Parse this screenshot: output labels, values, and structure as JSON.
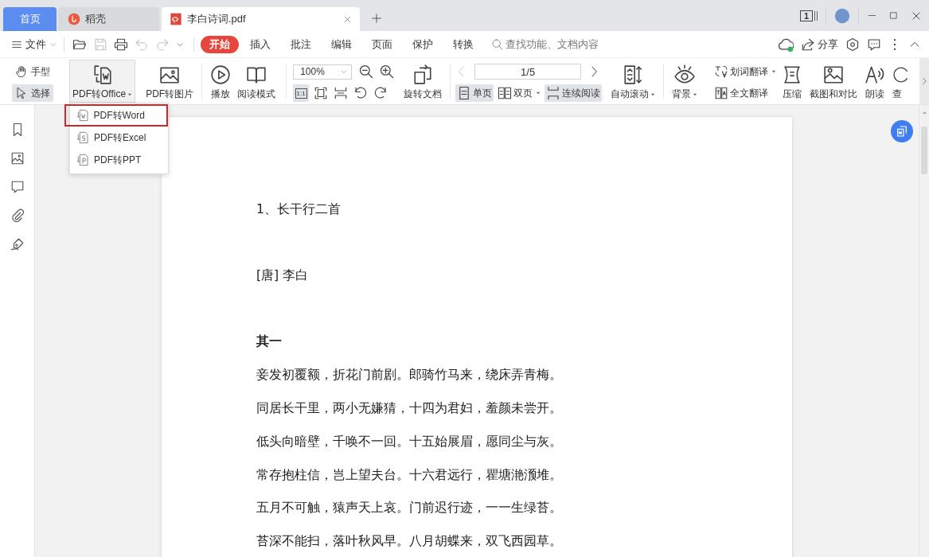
{
  "title_bar": {
    "tabs": [
      {
        "kind": "home",
        "label": "首页",
        "selected": false
      },
      {
        "kind": "app",
        "label": "稻壳",
        "selected": false
      },
      {
        "kind": "pdf",
        "label": "李白诗词.pdf",
        "selected": true
      }
    ],
    "window_count": "1"
  },
  "menu_bar": {
    "file_label": "文件",
    "quick_actions": [
      {
        "kind": "open",
        "disabled": false
      },
      {
        "kind": "save",
        "disabled": true
      },
      {
        "kind": "print",
        "disabled": false
      },
      {
        "kind": "undo",
        "disabled": true
      },
      {
        "kind": "redo",
        "disabled": true
      },
      {
        "kind": "customize",
        "disabled": false
      }
    ],
    "tabs": [
      {
        "label": "开始",
        "selected": true
      },
      {
        "label": "插入",
        "selected": false
      },
      {
        "label": "批注",
        "selected": false
      },
      {
        "label": "编辑",
        "selected": false
      },
      {
        "label": "页面",
        "selected": false
      },
      {
        "label": "保护",
        "selected": false
      },
      {
        "label": "转换",
        "selected": false
      }
    ],
    "search": {
      "placeholder": "查找功能、文档内容"
    },
    "share_label": "分享"
  },
  "toolbar": {
    "cursor_modes": [
      {
        "kind": "hand",
        "label": "手型",
        "selected": false
      },
      {
        "kind": "select",
        "label": "选择",
        "selected": true
      }
    ],
    "convert": [
      {
        "kind": "office",
        "label": "PDF转Office",
        "dropdown": true,
        "expanded": true
      },
      {
        "kind": "image",
        "label": "PDF转图片",
        "dropdown": false,
        "expanded": false
      }
    ],
    "view": [
      {
        "kind": "play",
        "label": "播放"
      },
      {
        "kind": "read-mode",
        "label": "阅读模式"
      }
    ],
    "zoom": {
      "value": "100%"
    },
    "fit_modes": [
      {
        "kind": "actual-size",
        "label": "1:1",
        "selected": true
      },
      {
        "kind": "fit-page",
        "selected": false
      },
      {
        "kind": "fit-width",
        "selected": false
      }
    ],
    "rotate_label": "旋转文档",
    "page_nav": {
      "value": "1/5",
      "previous_disabled": true
    },
    "page_layouts": [
      {
        "kind": "single",
        "label": "单页",
        "selected": true,
        "dropdown": false
      },
      {
        "kind": "double",
        "label": "双页",
        "selected": false,
        "dropdown": true
      },
      {
        "kind": "continuous",
        "label": "连续阅读",
        "selected": true,
        "dropdown": false
      }
    ],
    "auto_scroll": {
      "label": "自动滚动",
      "dropdown": true
    },
    "background": {
      "label": "背景",
      "dropdown": true
    },
    "translate": [
      {
        "kind": "word",
        "label": "划词翻译",
        "dropdown": true
      },
      {
        "kind": "full",
        "label": "全文翻译",
        "dropdown": false
      }
    ],
    "tools": [
      {
        "kind": "compress",
        "label": "压缩"
      },
      {
        "kind": "screenshot",
        "label": "截图和对比"
      },
      {
        "kind": "read-aloud",
        "label": "朗读"
      },
      {
        "kind": "find",
        "label": "查"
      }
    ]
  },
  "convert_menu": {
    "items": [
      {
        "kind": "word",
        "label": "PDF转Word",
        "highlighted": true
      },
      {
        "kind": "excel",
        "label": "PDF转Excel",
        "highlighted": false
      },
      {
        "kind": "ppt",
        "label": "PDF转PPT",
        "highlighted": false
      }
    ]
  },
  "document": {
    "lines": [
      {
        "kind": "title",
        "text": "1、长干行二首"
      },
      {
        "kind": "author",
        "text": "[唐] 李白"
      },
      {
        "kind": "heading",
        "text": "其一"
      },
      {
        "kind": "verse",
        "text": "妾发初覆额，折花门前剧。郎骑竹马来，绕床弄青梅。"
      },
      {
        "kind": "verse",
        "text": "同居长干里，两小无嫌猜，十四为君妇，羞颜未尝开。"
      },
      {
        "kind": "verse",
        "text": "低头向暗壁，千唤不一回。十五始展眉，愿同尘与灰。"
      },
      {
        "kind": "verse",
        "text": "常存抱柱信，岂上望夫台。十六君远行，瞿塘滟滪堆。"
      },
      {
        "kind": "verse",
        "text": "五月不可触，猿声天上哀。门前迟行迹，一一生绿苔。"
      },
      {
        "kind": "verse",
        "text": "苔深不能扫，落叶秋风早。八月胡蝶来，双飞西园草。"
      }
    ]
  }
}
